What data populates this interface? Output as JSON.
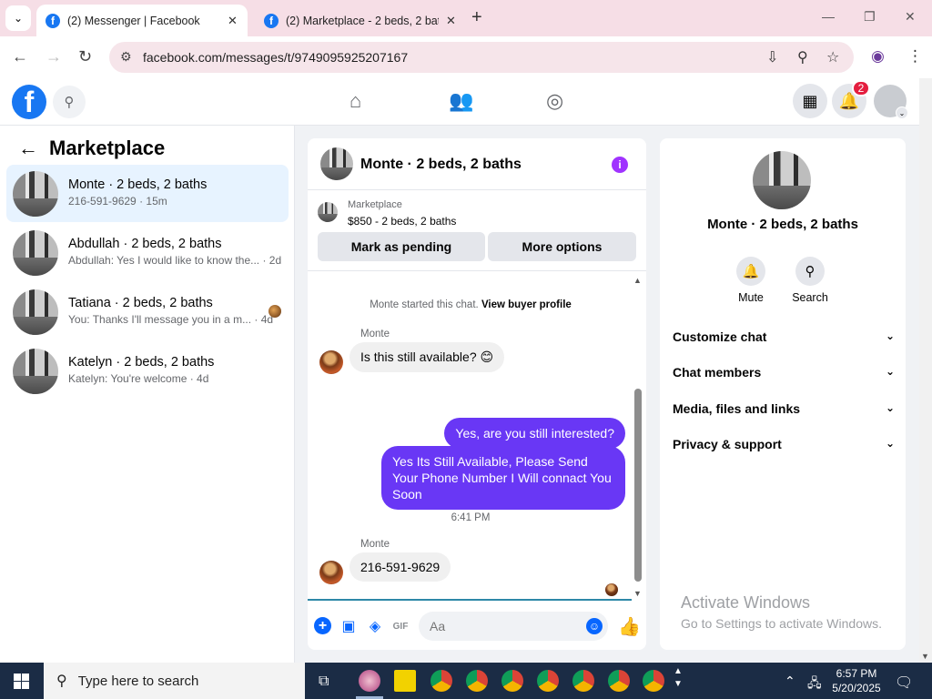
{
  "browser": {
    "tabs": [
      {
        "title": "(2) Messenger | Facebook",
        "active": true
      },
      {
        "title": "(2) Marketplace - 2 beds, 2 bath",
        "active": false
      }
    ],
    "url": "facebook.com/messages/t/9749095925207167"
  },
  "fb": {
    "notifications_count": "2"
  },
  "sidebar": {
    "title": "Marketplace",
    "conversations": [
      {
        "name": "Monte · 2 beds, 2 baths",
        "preview": "216-591-9629 · 15m",
        "selected": true
      },
      {
        "name": "Abdullah · 2 beds, 2 baths",
        "preview": "Abdullah: Yes I would like to know the... · 2d",
        "selected": false
      },
      {
        "name": "Tatiana · 2 beds, 2 baths",
        "preview": "You: Thanks I'll message you in a m... · 4d",
        "selected": false
      },
      {
        "name": "Katelyn · 2 beds, 2 baths",
        "preview": "Katelyn: You're welcome · 4d",
        "selected": false
      }
    ]
  },
  "chat": {
    "title": "Monte · 2 beds, 2 baths",
    "marketplace_label": "Marketplace",
    "listing": "$850 - 2 beds, 2 baths",
    "mark_pending": "Mark as pending",
    "more_options": "More options",
    "system_text": "Monte started this chat.",
    "system_link": "View buyer profile",
    "messages": [
      {
        "sender": "Monte",
        "text": "Is this still available? 😊",
        "direction": "in"
      },
      {
        "text": "Yes, are you still interested?",
        "direction": "out"
      },
      {
        "text": "Yes Its Still Available, Please Send Your Phone Number I Will connact You Soon",
        "direction": "out"
      },
      {
        "sender": "Monte",
        "text": "216-591-9629",
        "direction": "in"
      }
    ],
    "timestamp": "6:41 PM",
    "composer_placeholder": "Aa"
  },
  "details": {
    "name": "Monte · 2 beds, 2 baths",
    "actions": [
      {
        "label": "Mute",
        "icon": "bell-icon"
      },
      {
        "label": "Search",
        "icon": "search-icon"
      }
    ],
    "sections": [
      "Customize chat",
      "Chat members",
      "Media, files and links",
      "Privacy & support"
    ]
  },
  "watermark": {
    "line1": "Activate Windows",
    "line2": "Go to Settings to activate Windows."
  },
  "taskbar": {
    "search_placeholder": "Type here to search",
    "time": "6:57 PM",
    "date": "5/20/2025"
  },
  "colors": {
    "fb_blue": "#1877f2",
    "outgoing_bubble": "#6937f5",
    "selected_conv": "#e7f3ff",
    "info_icon": "#a033ff"
  }
}
